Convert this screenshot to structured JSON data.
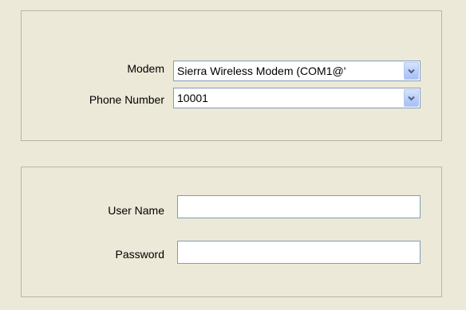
{
  "connection": {
    "modem": {
      "label": "Modem",
      "value": "Sierra Wireless Modem (COM1@'"
    },
    "phone_number": {
      "label": "Phone Number",
      "value": "10001"
    }
  },
  "credentials": {
    "user_name": {
      "label": "User Name",
      "value": ""
    },
    "password": {
      "label": "Password",
      "value": ""
    }
  },
  "icons": {
    "dropdown": "chevron-down-icon"
  },
  "colors": {
    "window_background": "#ece9d8",
    "group_border": "#b9b6a8",
    "input_border": "#7f9db9",
    "dropdown_button": "#c1d3fb",
    "dropdown_arrow": "#4d6185"
  }
}
